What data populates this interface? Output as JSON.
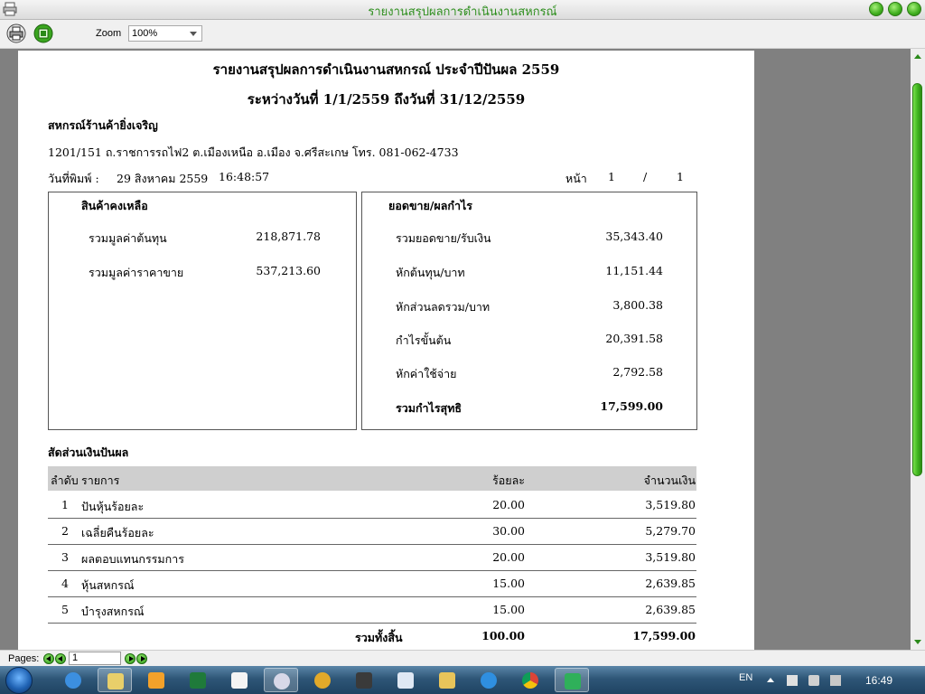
{
  "window": {
    "title": "รายงานสรุปผลการดำเนินงานสหกรณ์"
  },
  "toolbar": {
    "zoom_label": "Zoom",
    "zoom_value": "100%"
  },
  "report": {
    "title": "รายงานสรุปผลการดำเนินงานสหกรณ์  ประจำปีปันผล 2559",
    "period": "ระหว่างวันที่ 1/1/2559 ถึงวันที่ 31/12/2559",
    "company": "สหกรณ์ร้านค้ายิ่งเจริญ",
    "address": "1201/151 ถ.ราชการรถไฟ2 ต.เมืองเหนือ อ.เมือง จ.ศรีสะเกษ  โทร. 081-062-4733",
    "print_date_label": "วันที่พิมพ์ :",
    "print_date": "29 สิงหาคม 2559",
    "print_time": "16:48:57",
    "page_label": "หน้า",
    "page_current": "1",
    "page_sep": "/",
    "page_total": "1",
    "stock": {
      "heading": "สินค้าคงเหลือ",
      "items": [
        {
          "label": "รวมมูลค่าต้นทุน",
          "value": "218,871.78"
        },
        {
          "label": "รวมมูลค่าราคาขาย",
          "value": "537,213.60"
        }
      ]
    },
    "sales": {
      "heading": "ยอดขาย/ผลกำไร",
      "items": [
        {
          "label": "รวมยอดขาย/รับเงิน",
          "value": "35,343.40"
        },
        {
          "label": "หักต้นทุน/บาท",
          "value": "11,151.44"
        },
        {
          "label": "หักส่วนลดรวม/บาท",
          "value": "3,800.38"
        },
        {
          "label": "กำไรขั้นต้น",
          "value": "20,391.58"
        },
        {
          "label": "หักค่าใช้จ่าย",
          "value": "2,792.58"
        },
        {
          "label": "รวมกำไรสุทธิ",
          "value": "17,599.00"
        }
      ]
    },
    "dividend": {
      "heading": "สัดส่วนเงินปันผล",
      "columns": {
        "no": "ลำดับ",
        "item": "รายการ",
        "percent": "ร้อยละ",
        "amount": "จำนวนเงิน"
      },
      "rows": [
        {
          "no": "1",
          "item": "ปันหุ้นร้อยละ",
          "percent": "20.00",
          "amount": "3,519.80"
        },
        {
          "no": "2",
          "item": "เฉลี่ยคืนร้อยละ",
          "percent": "30.00",
          "amount": "5,279.70"
        },
        {
          "no": "3",
          "item": "ผลตอบแทนกรรมการ",
          "percent": "20.00",
          "amount": "3,519.80"
        },
        {
          "no": "4",
          "item": "หุ้นสหกรณ์",
          "percent": "15.00",
          "amount": "2,639.85"
        },
        {
          "no": "5",
          "item": "บำรุงสหกรณ์",
          "percent": "15.00",
          "amount": "2,639.85"
        }
      ],
      "total_label": "รวมทั้งสิ้น",
      "total_percent": "100.00",
      "total_amount": "17,599.00"
    }
  },
  "pager": {
    "label": "Pages:",
    "value": "1"
  },
  "taskbar": {
    "language": "EN",
    "time": "16:49"
  },
  "colors": {
    "title_green": "#2f8f1f",
    "header_gray": "#cfcfcf",
    "preview_bg": "#808080"
  }
}
